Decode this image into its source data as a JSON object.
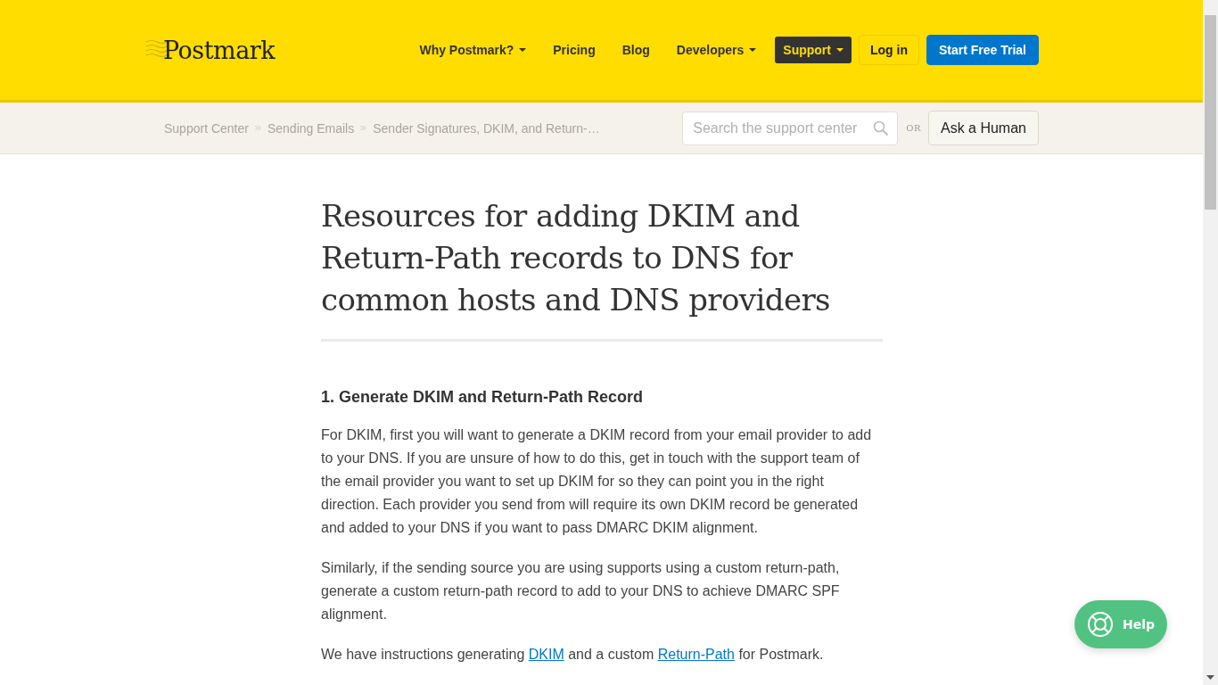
{
  "header": {
    "logo": "Postmark",
    "nav": [
      {
        "label": "Why Postmark?",
        "dropdown": true,
        "selected": false
      },
      {
        "label": "Pricing",
        "dropdown": false,
        "selected": false
      },
      {
        "label": "Blog",
        "dropdown": false,
        "selected": false
      },
      {
        "label": "Developers",
        "dropdown": true,
        "selected": false
      },
      {
        "label": "Support",
        "dropdown": true,
        "selected": true
      }
    ],
    "buttons": [
      {
        "kind": "outline",
        "label": "Log in"
      },
      {
        "kind": "primary",
        "label": "Start Free Trial"
      }
    ]
  },
  "subheader": {
    "breadcrumbs": [
      "Support Center",
      "Sending Emails",
      "Sender Signatures, DKIM, and Return-…"
    ],
    "search": {
      "placeholder": "Search the support center"
    },
    "or": "OR",
    "ask_button": "Ask a Human"
  },
  "article": {
    "title": "Resources for adding DKIM and Return-Path records to DNS for common hosts and DNS providers",
    "sections": [
      {
        "heading": "1. Generate DKIM and Return-Path Record",
        "paragraphs": [
          [
            {
              "kind": "text",
              "text": "For DKIM, first you will want to generate a DKIM record from your email provider to add to your DNS. If you are unsure of how to do this, get in touch with the support team of the email provider you want to set up DKIM for so they can point you in the right direction. Each provider you send from will require its own DKIM record be generated and added to your DNS if you want to pass DMARC DKIM alignment."
            }
          ],
          [
            {
              "kind": "text",
              "text": "Similarly, if the sending source you are using supports using a custom return-path, generate a custom return-path record to add to your DNS to achieve DMARC SPF alignment."
            }
          ],
          [
            {
              "kind": "text",
              "text": "We have instructions generating "
            },
            {
              "kind": "link",
              "text": "DKIM"
            },
            {
              "kind": "text",
              "text": " and a custom "
            },
            {
              "kind": "link",
              "text": "Return-Path"
            },
            {
              "kind": "text",
              "text": " for Postmark."
            }
          ]
        ]
      }
    ]
  },
  "help_button": "Help"
}
